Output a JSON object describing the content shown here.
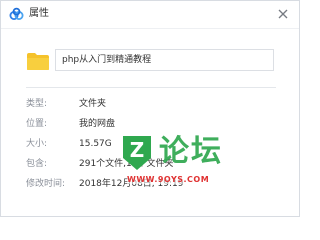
{
  "window": {
    "title": "属性"
  },
  "file": {
    "name": "php从入门到精通教程"
  },
  "details": [
    {
      "label": "类型:",
      "value": "文件夹"
    },
    {
      "label": "位置:",
      "value": "我的网盘"
    },
    {
      "label": "大小:",
      "value": "15.57G"
    },
    {
      "label": "包含:",
      "value": "291个文件,10个文件夹"
    },
    {
      "label": "修改时间:",
      "value": "2018年12月08日, 19:19"
    }
  ],
  "watermark": {
    "text": "论坛",
    "badge_text": "Z",
    "url": "WWW.9OYS.COM"
  },
  "colors": {
    "accent": "#2f7fe8",
    "folder": "#f5c22b",
    "watermark_green": "#2fa84f",
    "watermark_red": "#e03232"
  },
  "icons": {
    "app": "baidu-netdisk-cloud-icon",
    "close": "close-icon",
    "folder": "folder-icon"
  }
}
